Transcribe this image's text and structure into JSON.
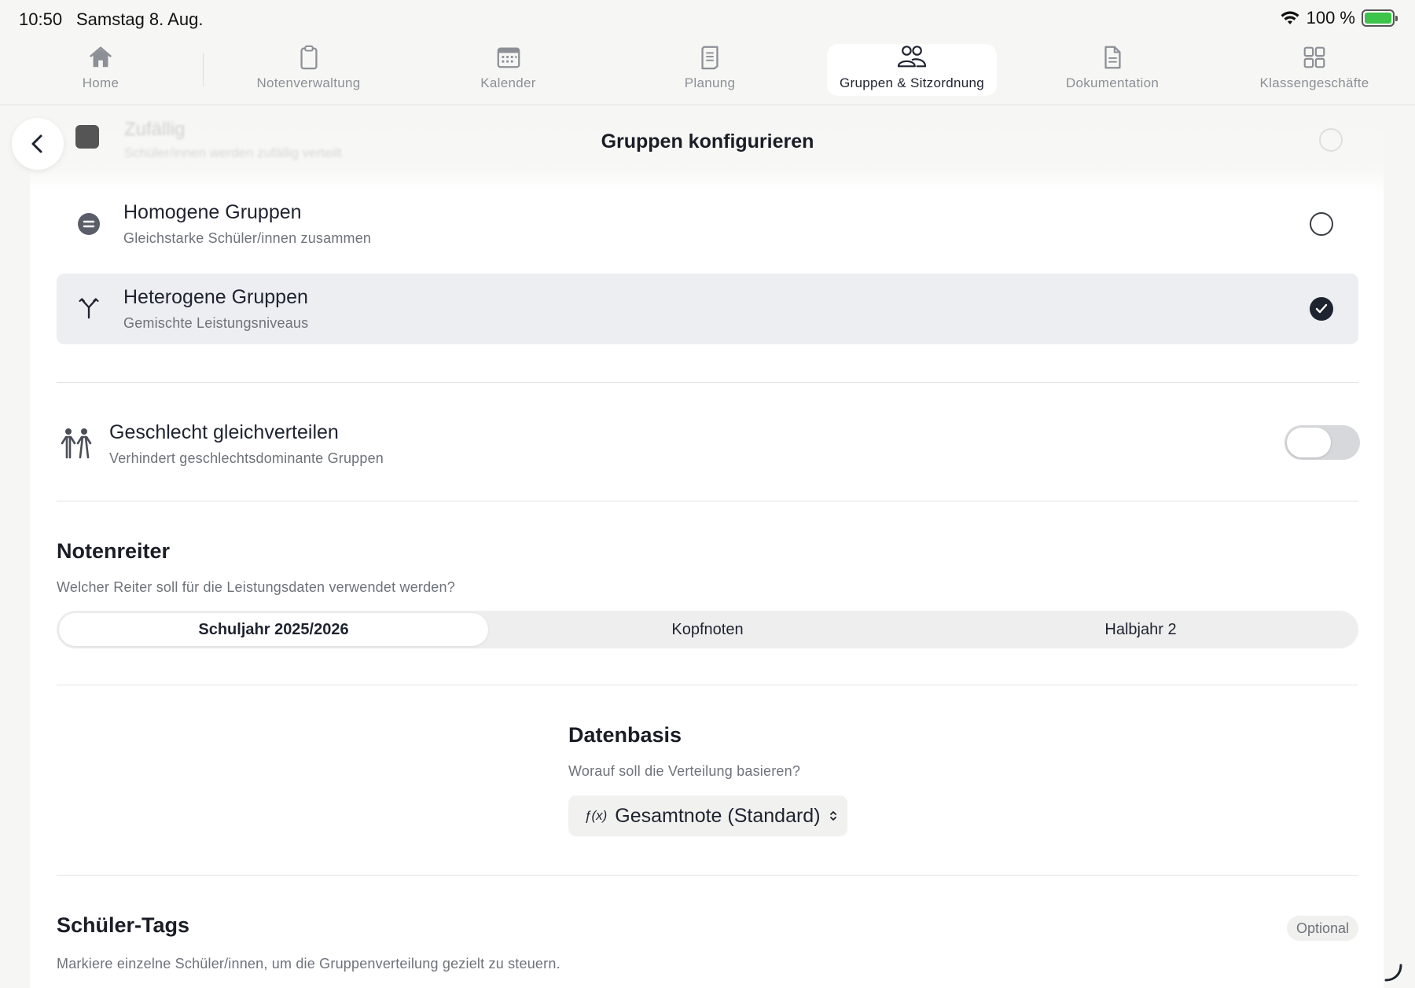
{
  "status_bar": {
    "time": "10:50",
    "date": "Samstag 8. Aug.",
    "battery": "100 %"
  },
  "tabs": [
    {
      "label": "Home",
      "icon": "home-icon"
    },
    {
      "label": "Notenverwaltung",
      "icon": "clipboard-icon"
    },
    {
      "label": "Kalender",
      "icon": "calendar-icon"
    },
    {
      "label": "Planung",
      "icon": "notebook-icon"
    },
    {
      "label": "Gruppen & Sitzordnung",
      "icon": "people-icon",
      "active": true
    },
    {
      "label": "Dokumentation",
      "icon": "document-icon"
    },
    {
      "label": "Klassengeschäfte",
      "icon": "grid-icon"
    }
  ],
  "header": {
    "title": "Gruppen konfigurieren"
  },
  "ghost_option": {
    "title": "Zufällig",
    "subtitle": "Schüler/innen werden zufällig verteilt"
  },
  "options": [
    {
      "title": "Homogene Gruppen",
      "subtitle": "Gleichstarke Schüler/innen zusammen",
      "selected": false
    },
    {
      "title": "Heterogene Gruppen",
      "subtitle": "Gemischte Leistungsniveaus",
      "selected": true
    }
  ],
  "gender": {
    "title": "Geschlecht gleichverteilen",
    "subtitle": "Verhindert geschlechtsdominante Gruppen",
    "enabled": false
  },
  "notenreiter": {
    "title": "Notenreiter",
    "subtitle": "Welcher Reiter soll für die Leistungsdaten verwendet werden?",
    "segments": [
      "Schuljahr 2025/2026",
      "Kopfnoten",
      "Halbjahr 2"
    ],
    "selected": "Schuljahr 2025/2026"
  },
  "datenbasis": {
    "title": "Datenbasis",
    "subtitle": "Worauf soll die Verteilung basieren?",
    "fx_label": "ƒ(x)",
    "value": "Gesamtnote (Standard)"
  },
  "schueler_tags": {
    "title": "Schüler-Tags",
    "badge": "Optional",
    "subtitle": "Markiere einzelne Schüler/innen, um die Gruppenverteilung gezielt zu steuern."
  },
  "colors": {
    "background": "#f6f6f4",
    "card": "#ffffff",
    "selected_row": "#eceef1",
    "text_primary": "#1e2330",
    "text_secondary": "#6e727a",
    "toggle_off": "#d7d8db",
    "battery": "#3cc34a"
  }
}
